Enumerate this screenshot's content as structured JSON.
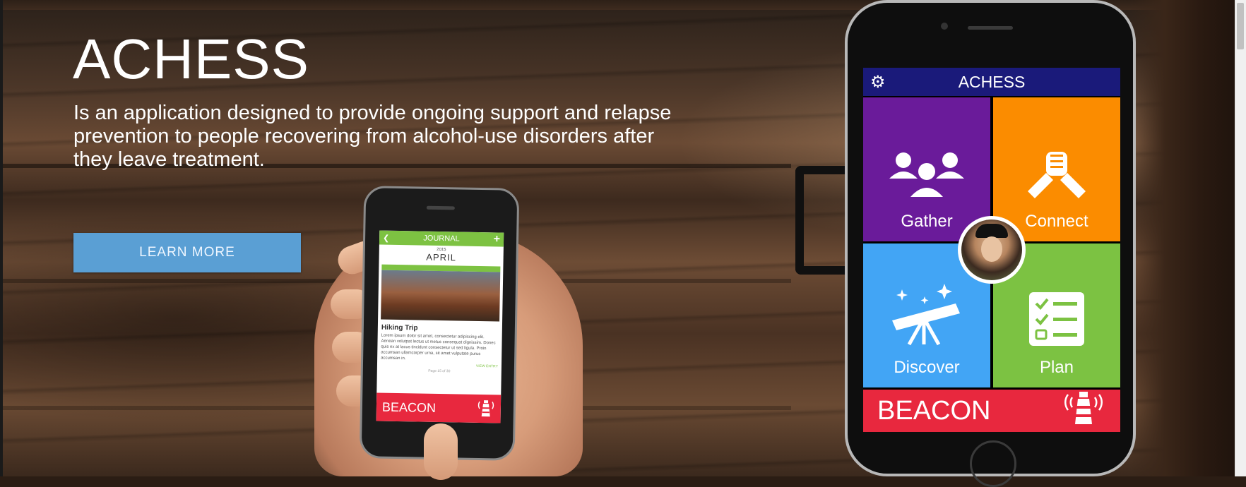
{
  "hero": {
    "title": "ACHESS",
    "description": "Is an application designed to provide ongoing support and relapse prevention to people recovering from alcohol-use disorders after they leave treatment.",
    "cta_label": "LEARN MORE"
  },
  "small_phone": {
    "header_title": "JOURNAL",
    "year": "2015",
    "month": "APRIL",
    "entry_title": "Hiking Trip",
    "entry_text": "Lorem ipsum dolor sit amet, consectetur adipiscing elit. Aenean volutpat lectus ut metus consequat dignissim. Donec quis ex at lacus tincidunt consectetur ut sed ligula. Proin accumsan ullamcorper urna, sit amet vulputate purus accumsan in.",
    "view_entry": "VIEW ENTRY",
    "pager": "Page 15 of 30",
    "beacon_label": "BEACON"
  },
  "big_phone": {
    "app_title": "ACHESS",
    "tiles": [
      {
        "label": "Gather",
        "color": "#6a1b9a",
        "icon": "group-icon"
      },
      {
        "label": "Connect",
        "color": "#fb8c00",
        "icon": "handshake-icon"
      },
      {
        "label": "Discover",
        "color": "#42a5f5",
        "icon": "telescope-icon"
      },
      {
        "label": "Plan",
        "color": "#7cc242",
        "icon": "checklist-icon"
      }
    ],
    "beacon_label": "BEACON",
    "beacon_color": "#e8283e",
    "header_color": "#1a1a7a"
  },
  "colors": {
    "button": "#5a9fd4"
  }
}
